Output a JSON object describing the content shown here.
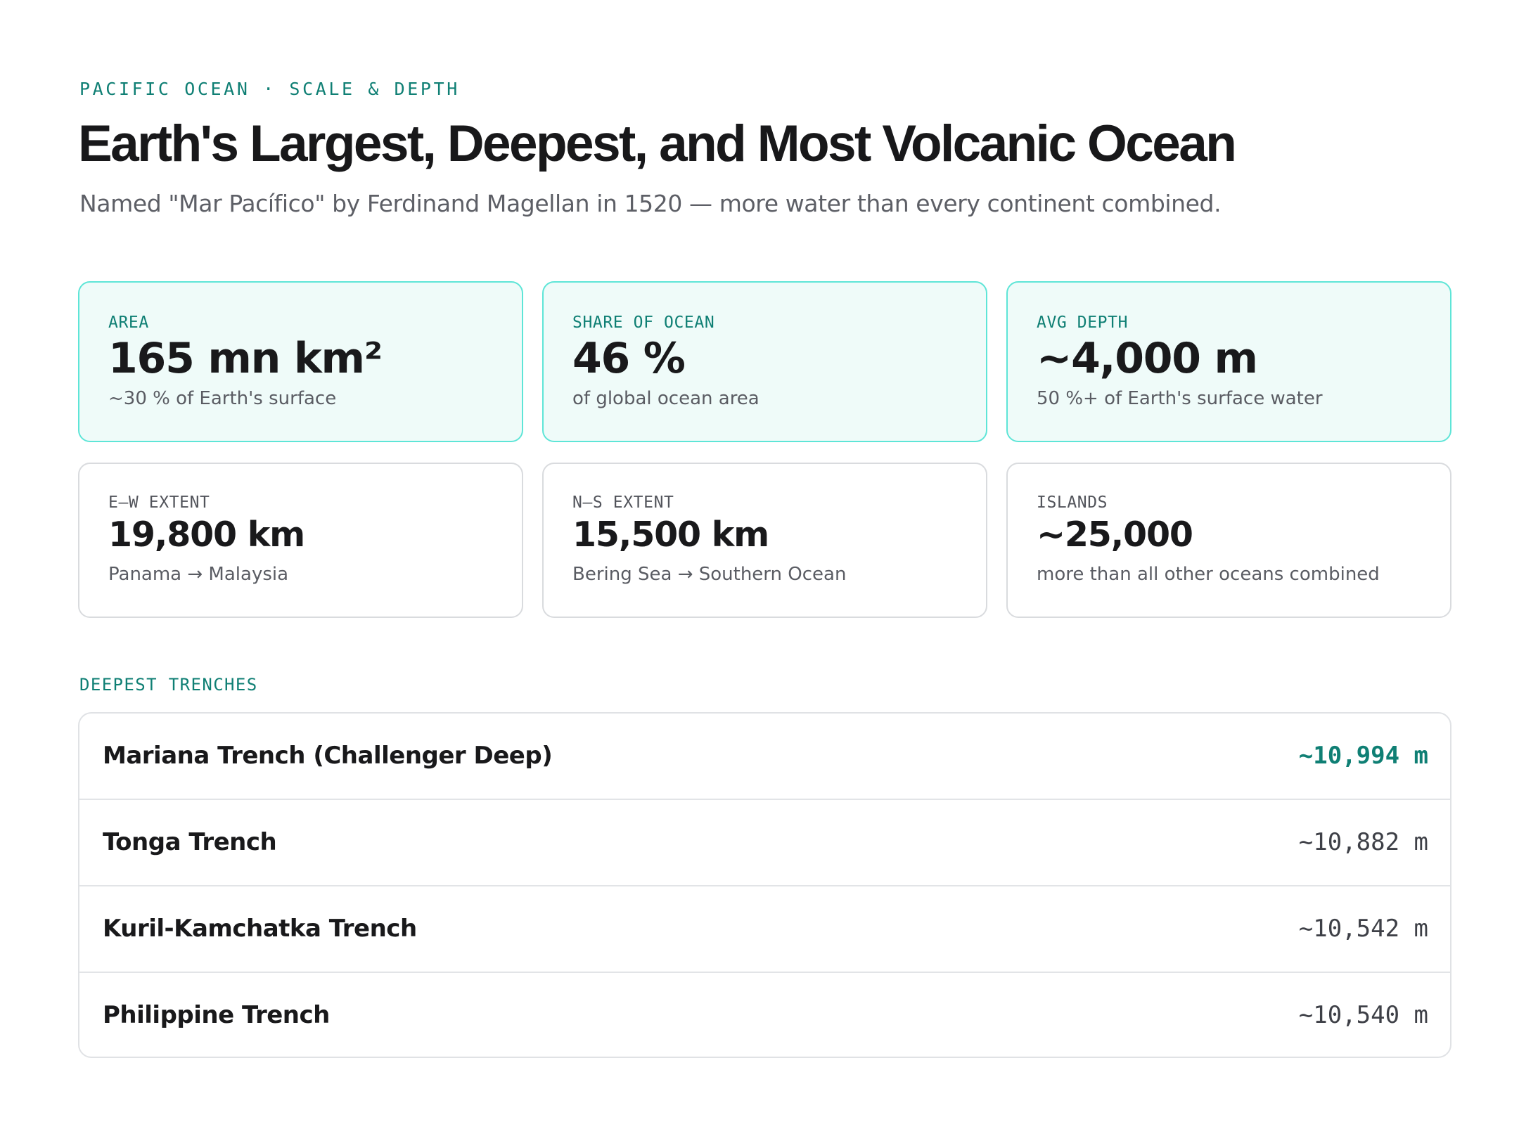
{
  "header": {
    "eyebrow": "PACIFIC OCEAN · SCALE & DEPTH",
    "title": "Earth's Largest, Deepest, and Most Volcanic Ocean",
    "subtitle": "Named \"Mar Pacífico\" by Ferdinand Magellan in 1520 — more water than every continent combined."
  },
  "stats": [
    {
      "label": "AREA",
      "value": "165 mn km²",
      "sub": "~30 % of Earth's surface"
    },
    {
      "label": "SHARE OF OCEAN",
      "value": "46 %",
      "sub": "of global ocean area"
    },
    {
      "label": "AVG DEPTH",
      "value": "~4,000 m",
      "sub": "50 %+ of Earth's surface water"
    },
    {
      "label": "E–W EXTENT",
      "value": "19,800 km",
      "sub": "Panama → Malaysia"
    },
    {
      "label": "N–S EXTENT",
      "value": "15,500 km",
      "sub": "Bering Sea → Southern Ocean"
    },
    {
      "label": "ISLANDS",
      "value": "~25,000",
      "sub": "more than all other oceans combined"
    }
  ],
  "trenches": {
    "section_label": "DEEPEST TRENCHES",
    "rows": [
      {
        "name": "Mariana Trench (Challenger Deep)",
        "depth": "~10,994 m"
      },
      {
        "name": "Tonga Trench",
        "depth": "~10,882 m"
      },
      {
        "name": "Kuril-Kamchatka Trench",
        "depth": "~10,542 m"
      },
      {
        "name": "Philippine Trench",
        "depth": "~10,540 m"
      }
    ]
  },
  "colors": {
    "accent": "#0f7f74",
    "accent_border": "#5ee5d7",
    "accent_bg": "#effbf9"
  }
}
